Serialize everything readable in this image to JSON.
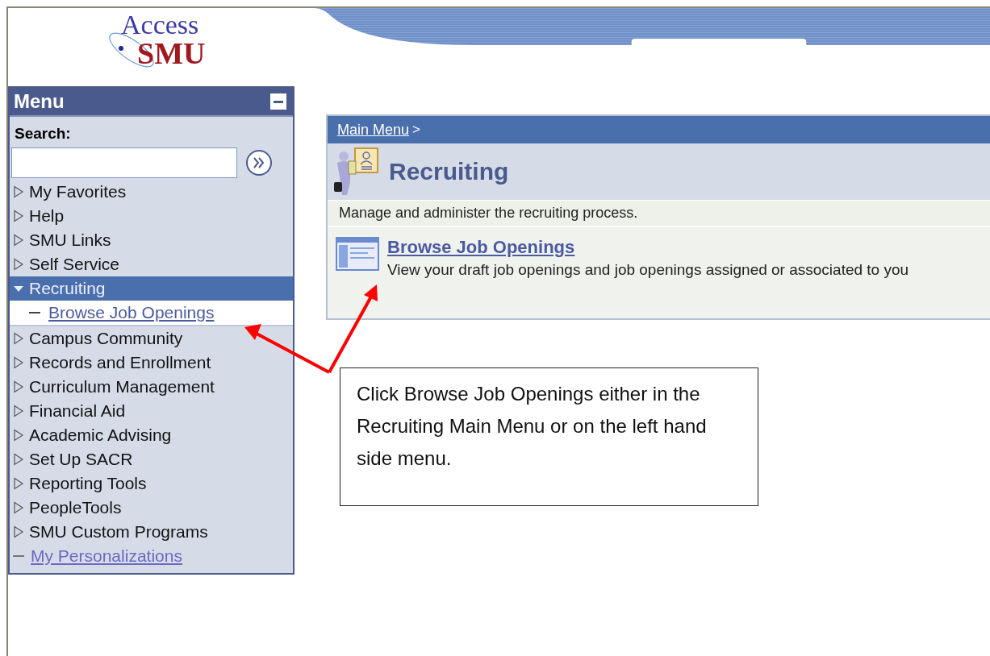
{
  "logo": {
    "line_1": "Access",
    "line_2": "SMU"
  },
  "menu": {
    "title": "Menu",
    "search_label": "Search:",
    "items": [
      {
        "label": "My Favorites",
        "kind": "folder",
        "selected": false,
        "expanded": false
      },
      {
        "label": "Help",
        "kind": "folder",
        "selected": false,
        "expanded": false
      },
      {
        "label": "SMU Links",
        "kind": "folder",
        "selected": false,
        "expanded": false
      },
      {
        "label": "Self Service",
        "kind": "folder",
        "selected": false,
        "expanded": false
      },
      {
        "label": "Recruiting",
        "kind": "folder",
        "selected": true,
        "expanded": true,
        "children": [
          {
            "label": "Browse Job Openings",
            "kind": "link"
          }
        ]
      },
      {
        "label": "Campus Community",
        "kind": "folder",
        "selected": false,
        "expanded": false
      },
      {
        "label": "Records and Enrollment",
        "kind": "folder",
        "selected": false,
        "expanded": false
      },
      {
        "label": "Curriculum Management",
        "kind": "folder",
        "selected": false,
        "expanded": false
      },
      {
        "label": "Financial Aid",
        "kind": "folder",
        "selected": false,
        "expanded": false
      },
      {
        "label": "Academic Advising",
        "kind": "folder",
        "selected": false,
        "expanded": false
      },
      {
        "label": "Set Up SACR",
        "kind": "folder",
        "selected": false,
        "expanded": false
      },
      {
        "label": "Reporting Tools",
        "kind": "folder",
        "selected": false,
        "expanded": false
      },
      {
        "label": "PeopleTools",
        "kind": "folder",
        "selected": false,
        "expanded": false
      },
      {
        "label": "SMU Custom Programs",
        "kind": "folder",
        "selected": false,
        "expanded": false
      },
      {
        "label": "My Personalizations",
        "kind": "link",
        "selected": false
      }
    ]
  },
  "content": {
    "breadcrumb": {
      "link": "Main Menu",
      "separator": ">"
    },
    "title": "Recruiting",
    "description": "Manage and administer the recruiting process.",
    "links": [
      {
        "title": "Browse Job Openings",
        "description": "View your draft job openings and job openings assigned or associated to you"
      }
    ]
  },
  "callout": {
    "text": "Click Browse Job Openings either in the Recruiting Main Menu or on the left hand side menu."
  }
}
